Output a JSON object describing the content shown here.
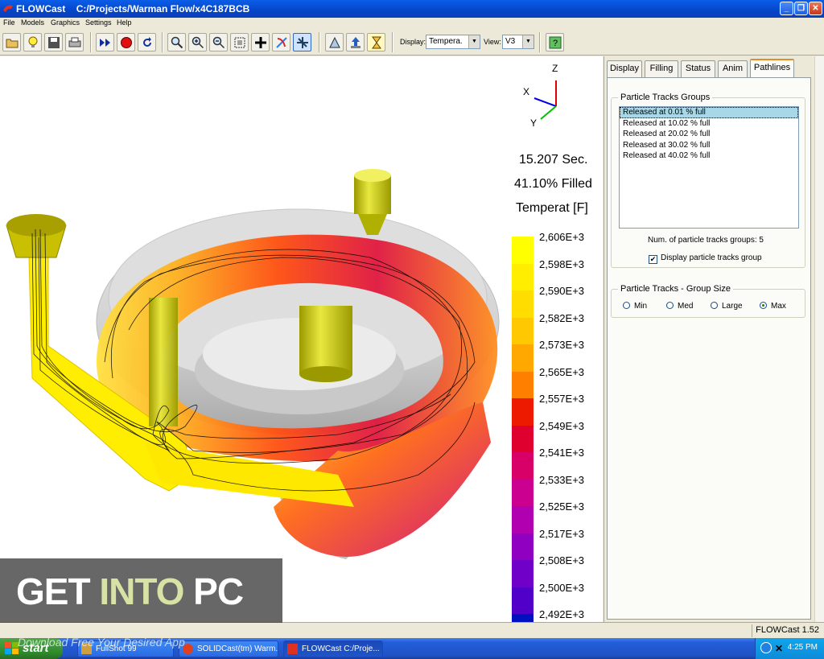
{
  "window": {
    "app_name": "FLOWCast",
    "path": "C:/Projects/Warman Flow/x4C187BCB",
    "controls": [
      "minimize-icon",
      "maximize-icon",
      "close-icon"
    ]
  },
  "menu": [
    "File",
    "Models",
    "Graphics",
    "Settings",
    "Help"
  ],
  "toolbar": {
    "buttons": [
      "open-icon",
      "lightbulb-icon",
      "save-icon",
      "print-icon",
      "fast-forward-icon",
      "record-stop-icon",
      "rewind-icon",
      "zoom-icon",
      "zoom-in-icon",
      "zoom-out-icon",
      "fit-view-icon",
      "pan-icon",
      "rotate-icon",
      "cut-plane-icon",
      "solid-view-icon",
      "export-icon",
      "hourglass-icon",
      "help-icon"
    ],
    "display_label": "Display:",
    "display_value": "Tempera.",
    "view_label": "View:",
    "view_value": "V3"
  },
  "viewport": {
    "axes": {
      "x": "X",
      "y": "Y",
      "z": "Z"
    },
    "time": "15.207 Sec.",
    "filled": "41.10% Filled",
    "quantity": "Temperat [F]",
    "legend": {
      "labels": [
        "2,606E+3",
        "2,598E+3",
        "2,590E+3",
        "2,582E+3",
        "2,573E+3",
        "2,565E+3",
        "2,557E+3",
        "2,549E+3",
        "2,541E+3",
        "2,533E+3",
        "2,525E+3",
        "2,517E+3",
        "2,508E+3",
        "2,500E+3",
        "2,492E+3"
      ],
      "colors": [
        "#ffff00",
        "#ffee00",
        "#ffdd00",
        "#ffc800",
        "#ffa800",
        "#ff8000",
        "#ee1a00",
        "#e00030",
        "#d80068",
        "#cc0090",
        "#b000b0",
        "#9000c0",
        "#7000c8",
        "#5000c8",
        "#0010c0"
      ]
    }
  },
  "tabs": [
    "Display",
    "Filling",
    "Status",
    "Anim",
    "Pathlines"
  ],
  "active_tab": "Pathlines",
  "pathlines": {
    "tracks_group_title": "Particle Tracks Groups",
    "tracks": [
      "Released at   0.01 % full",
      "Released at  10.02 % full",
      "Released at  20.02 % full",
      "Released at  30.02 % full",
      "Released at  40.02 % full"
    ],
    "num_groups_text": "Num. of particle tracks groups: 5",
    "display_checkbox_label": "Display particle tracks group",
    "display_checkbox_checked": true,
    "size_group_title": "Particle Tracks - Group Size",
    "size_options": [
      "Min",
      "Med",
      "Large",
      "Max"
    ],
    "size_selected": "Max"
  },
  "status": {
    "version": "FLOWCast 1.52"
  },
  "taskbar": {
    "start_label": "start",
    "tasks": [
      "FullShot 99",
      "SOLIDCast(tm) Warm...",
      "FLOWCast    C:/Proje..."
    ],
    "clock": "4:25 PM"
  },
  "watermark": {
    "get": "GET ",
    "into": "INTO",
    "pc": " PC",
    "subtitle": "Download Free Your Desired App"
  }
}
